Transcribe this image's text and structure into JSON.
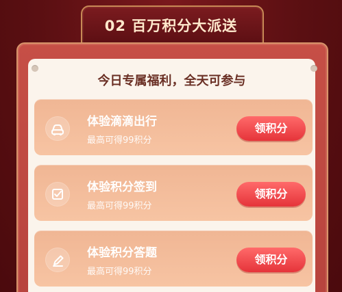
{
  "header": {
    "title": "02 百万积分大派送"
  },
  "section": {
    "title": "今日专属福利，全天可参与"
  },
  "tasks": [
    {
      "icon": "car-icon",
      "title": "体验滴滴出行",
      "subtitle": "最高可得99积分",
      "button": "领积分"
    },
    {
      "icon": "checkin-icon",
      "title": "体验积分签到",
      "subtitle": "最高可得99积分",
      "button": "领积分"
    },
    {
      "icon": "pen-icon",
      "title": "体验积分答题",
      "subtitle": "最高可得99积分",
      "button": "领积分"
    }
  ],
  "colors": {
    "background": "#5a0f12",
    "accent": "#e5343a",
    "card": "#f7c4a3",
    "frame": "#c64f46"
  }
}
